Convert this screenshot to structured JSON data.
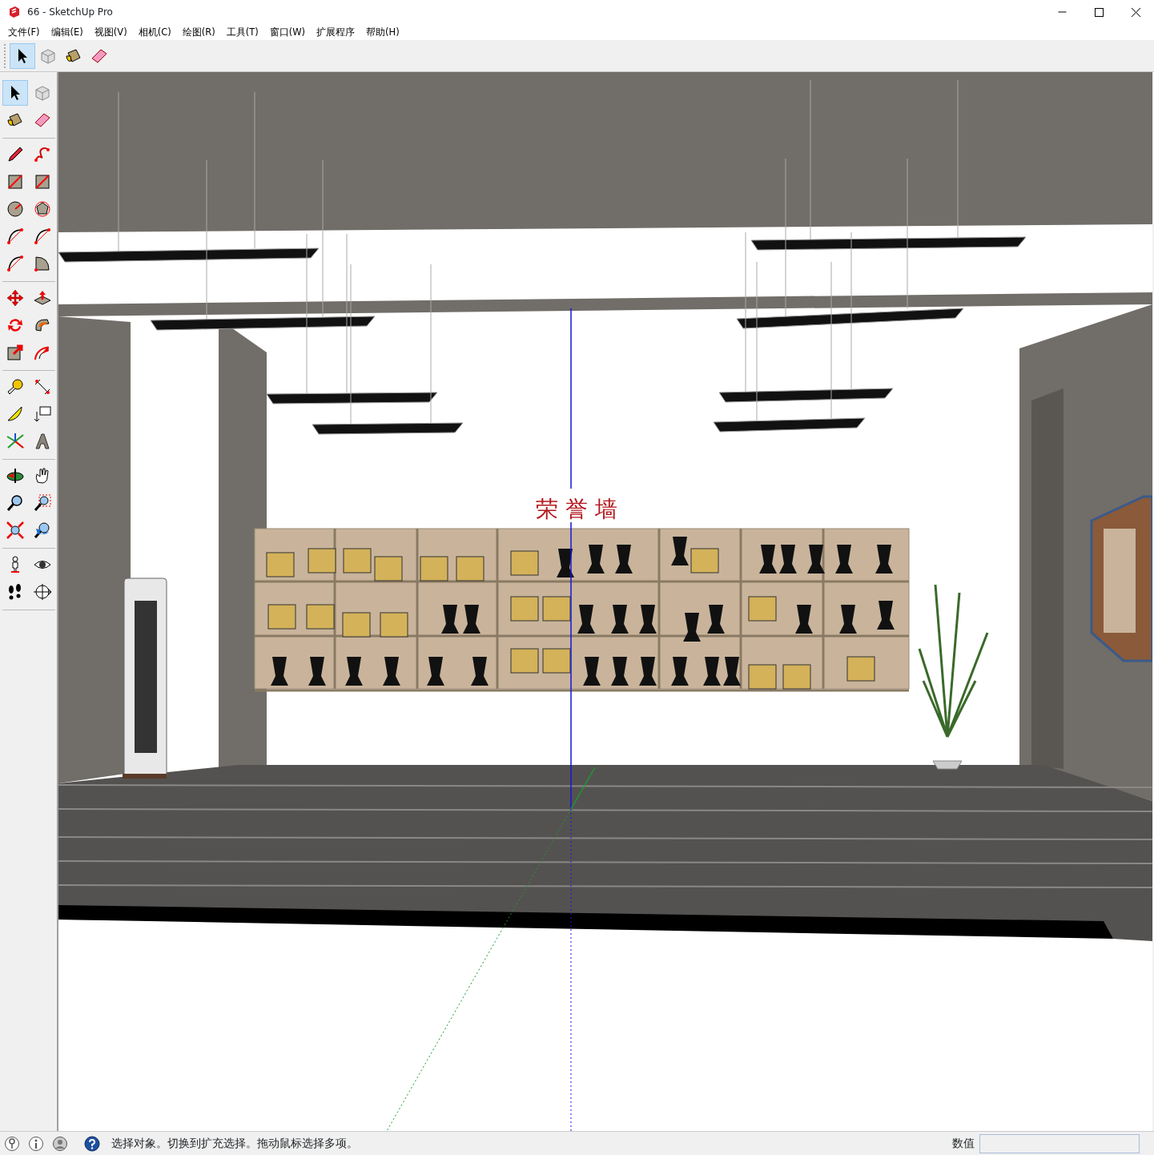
{
  "window": {
    "title": "66 - SketchUp Pro"
  },
  "menu": [
    "文件(F)",
    "编辑(E)",
    "视图(V)",
    "相机(C)",
    "绘图(R)",
    "工具(T)",
    "窗口(W)",
    "扩展程序",
    "帮助(H)"
  ],
  "toolbar": {
    "tools": [
      {
        "selected": true
      },
      {
        "selected": false
      },
      {
        "selected": false
      },
      {
        "selected": false
      }
    ]
  },
  "tool_palette": {
    "groups": [
      {
        "tools": [
          {
            "selected": true
          },
          {
            "selected": false
          },
          {
            "selected": false
          },
          {
            "selected": false
          }
        ]
      },
      {
        "tools": [
          {
            "selected": false
          },
          {
            "selected": false
          },
          {
            "selected": false
          },
          {
            "selected": false
          },
          {
            "selected": false
          },
          {
            "selected": false
          },
          {
            "selected": false
          },
          {
            "selected": false
          },
          {
            "selected": false
          },
          {
            "selected": false
          }
        ]
      },
      {
        "tools": [
          {
            "selected": false
          },
          {
            "selected": false
          },
          {
            "selected": false
          },
          {
            "selected": false
          },
          {
            "selected": false
          },
          {
            "selected": false
          }
        ]
      },
      {
        "tools": [
          {
            "selected": false
          },
          {
            "selected": false
          },
          {
            "selected": false
          },
          {
            "selected": false
          },
          {
            "selected": false
          },
          {
            "selected": false
          }
        ]
      },
      {
        "tools": [
          {
            "selected": false
          },
          {
            "selected": false
          },
          {
            "selected": false
          },
          {
            "selected": false
          },
          {
            "selected": false
          },
          {
            "selected": false
          }
        ]
      },
      {
        "tools": [
          {
            "selected": false
          },
          {
            "selected": false
          },
          {
            "selected": false
          },
          {
            "selected": false
          }
        ]
      }
    ]
  },
  "viewport": {
    "wall_sign": "荣 誉 墙"
  },
  "status_bar": {
    "message": "选择对象。切换到扩充选择。拖动鼠标选择多项。",
    "measurements_label": "数值"
  }
}
